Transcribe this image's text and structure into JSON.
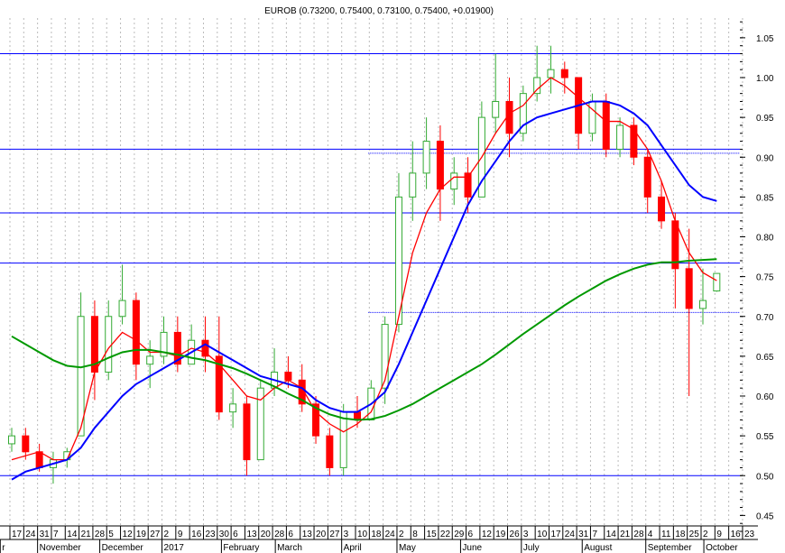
{
  "chart_data": {
    "type": "candlestick",
    "title": "EUROB (0.73200, 0.75400, 0.73100, 0.75400, +0.01900)",
    "xlabel": "",
    "ylabel": "",
    "ylim": [
      0.43,
      1.08
    ],
    "y_ticks": [
      "0.45",
      "0.50",
      "0.55",
      "0.60",
      "0.65",
      "0.70",
      "0.75",
      "0.80",
      "0.85",
      "0.90",
      "0.95",
      "1.00",
      "1.05"
    ],
    "week_labels": [
      "17",
      "24",
      "31",
      "7",
      "14",
      "21",
      "28",
      "5",
      "12",
      "19",
      "27",
      "2",
      "9",
      "16",
      "23",
      "30",
      "6",
      "13",
      "20",
      "28",
      "6",
      "13",
      "20",
      "27",
      "3",
      "10",
      "18",
      "24",
      "2",
      "8",
      "15",
      "22",
      "29",
      "6",
      "12",
      "19",
      "26",
      "3",
      "10",
      "17",
      "24",
      "31",
      "7",
      "14",
      "21",
      "28",
      "4",
      "11",
      "18",
      "25",
      "2",
      "9",
      "16",
      "23"
    ],
    "month_labels": [
      {
        "label": "r",
        "week": -0.7
      },
      {
        "label": "November",
        "week": 2
      },
      {
        "label": "December",
        "week": 6.5
      },
      {
        "label": "2017",
        "week": 11
      },
      {
        "label": "February",
        "week": 15.3
      },
      {
        "label": "March",
        "week": 19.2
      },
      {
        "label": "April",
        "week": 24
      },
      {
        "label": "May",
        "week": 28
      },
      {
        "label": "June",
        "week": 32.6
      },
      {
        "label": "July",
        "week": 37
      },
      {
        "label": "August",
        "week": 41.4
      },
      {
        "label": "September",
        "week": 46
      },
      {
        "label": "October",
        "week": 50.2
      }
    ],
    "candles": [
      [
        0.54,
        0.56,
        0.53,
        0.55
      ],
      [
        0.55,
        0.56,
        0.52,
        0.53
      ],
      [
        0.53,
        0.54,
        0.505,
        0.51
      ],
      [
        0.51,
        0.53,
        0.49,
        0.52
      ],
      [
        0.52,
        0.535,
        0.51,
        0.53
      ],
      [
        0.55,
        0.73,
        0.55,
        0.7
      ],
      [
        0.7,
        0.72,
        0.595,
        0.63
      ],
      [
        0.63,
        0.72,
        0.62,
        0.7
      ],
      [
        0.7,
        0.765,
        0.69,
        0.72
      ],
      [
        0.72,
        0.73,
        0.62,
        0.64
      ],
      [
        0.64,
        0.67,
        0.61,
        0.65
      ],
      [
        0.65,
        0.7,
        0.64,
        0.68
      ],
      [
        0.68,
        0.7,
        0.63,
        0.64
      ],
      [
        0.64,
        0.69,
        0.64,
        0.67
      ],
      [
        0.67,
        0.7,
        0.63,
        0.65
      ],
      [
        0.65,
        0.7,
        0.57,
        0.58
      ],
      [
        0.58,
        0.61,
        0.56,
        0.59
      ],
      [
        0.59,
        0.6,
        0.5,
        0.52
      ],
      [
        0.52,
        0.62,
        0.52,
        0.61
      ],
      [
        0.61,
        0.66,
        0.6,
        0.63
      ],
      [
        0.63,
        0.65,
        0.61,
        0.62
      ],
      [
        0.62,
        0.64,
        0.58,
        0.59
      ],
      [
        0.59,
        0.6,
        0.54,
        0.55
      ],
      [
        0.55,
        0.56,
        0.5,
        0.51
      ],
      [
        0.51,
        0.59,
        0.5,
        0.58
      ],
      [
        0.58,
        0.6,
        0.56,
        0.57
      ],
      [
        0.57,
        0.62,
        0.57,
        0.61
      ],
      [
        0.61,
        0.7,
        0.59,
        0.69
      ],
      [
        0.69,
        0.88,
        0.68,
        0.85
      ],
      [
        0.85,
        0.92,
        0.82,
        0.88
      ],
      [
        0.88,
        0.95,
        0.86,
        0.92
      ],
      [
        0.92,
        0.94,
        0.82,
        0.86
      ],
      [
        0.86,
        0.9,
        0.84,
        0.88
      ],
      [
        0.88,
        0.9,
        0.83,
        0.85
      ],
      [
        0.85,
        0.97,
        0.85,
        0.95
      ],
      [
        0.95,
        1.03,
        0.93,
        0.97
      ],
      [
        0.97,
        1.0,
        0.9,
        0.93
      ],
      [
        0.93,
        0.99,
        0.92,
        0.98
      ],
      [
        0.98,
        1.04,
        0.97,
        1.0
      ],
      [
        1.0,
        1.04,
        0.98,
        1.01
      ],
      [
        1.01,
        1.02,
        0.98,
        1.0
      ],
      [
        1.0,
        1.0,
        0.91,
        0.93
      ],
      [
        0.93,
        0.98,
        0.92,
        0.97
      ],
      [
        0.97,
        0.98,
        0.9,
        0.91
      ],
      [
        0.91,
        0.95,
        0.9,
        0.94
      ],
      [
        0.94,
        0.95,
        0.89,
        0.9
      ],
      [
        0.9,
        0.91,
        0.83,
        0.85
      ],
      [
        0.85,
        0.87,
        0.81,
        0.82
      ],
      [
        0.82,
        0.83,
        0.71,
        0.76
      ],
      [
        0.76,
        0.81,
        0.6,
        0.71
      ],
      [
        0.71,
        0.76,
        0.69,
        0.72
      ],
      [
        0.732,
        0.754,
        0.731,
        0.754
      ]
    ],
    "series": [
      {
        "name": "short MA",
        "color": "#ff0000",
        "values": [
          0.52,
          0.525,
          0.53,
          0.52,
          0.52,
          0.56,
          0.63,
          0.66,
          0.68,
          0.67,
          0.655,
          0.655,
          0.65,
          0.66,
          0.655,
          0.64,
          0.62,
          0.6,
          0.595,
          0.61,
          0.62,
          0.61,
          0.58,
          0.565,
          0.555,
          0.565,
          0.58,
          0.62,
          0.7,
          0.78,
          0.83,
          0.86,
          0.875,
          0.875,
          0.9,
          0.93,
          0.955,
          0.965,
          0.985,
          1.0,
          0.99,
          0.975,
          0.96,
          0.945,
          0.945,
          0.935,
          0.91,
          0.87,
          0.82,
          0.78,
          0.755,
          0.745
        ]
      },
      {
        "name": "medium MA",
        "color": "#0000ff",
        "values": [
          0.495,
          0.505,
          0.51,
          0.515,
          0.52,
          0.535,
          0.56,
          0.58,
          0.6,
          0.615,
          0.625,
          0.635,
          0.645,
          0.655,
          0.665,
          0.655,
          0.645,
          0.635,
          0.625,
          0.62,
          0.615,
          0.61,
          0.595,
          0.585,
          0.58,
          0.58,
          0.59,
          0.605,
          0.64,
          0.68,
          0.72,
          0.76,
          0.8,
          0.84,
          0.87,
          0.895,
          0.92,
          0.94,
          0.95,
          0.955,
          0.96,
          0.965,
          0.97,
          0.97,
          0.965,
          0.955,
          0.94,
          0.915,
          0.89,
          0.865,
          0.85,
          0.845
        ]
      },
      {
        "name": "long MA",
        "color": "#009900",
        "values": [
          0.675,
          0.665,
          0.655,
          0.645,
          0.638,
          0.636,
          0.64,
          0.648,
          0.655,
          0.658,
          0.658,
          0.655,
          0.652,
          0.648,
          0.645,
          0.64,
          0.635,
          0.628,
          0.62,
          0.612,
          0.603,
          0.595,
          0.585,
          0.577,
          0.572,
          0.57,
          0.571,
          0.575,
          0.582,
          0.59,
          0.6,
          0.61,
          0.62,
          0.63,
          0.64,
          0.652,
          0.665,
          0.678,
          0.69,
          0.702,
          0.714,
          0.725,
          0.735,
          0.745,
          0.753,
          0.76,
          0.765,
          0.768,
          0.768,
          0.77,
          0.771,
          0.772
        ]
      }
    ],
    "horizontal_lines": [
      {
        "value": 1.03,
        "style": "solid",
        "from_week": -1
      },
      {
        "value": 0.91,
        "style": "solid",
        "from_week": -1
      },
      {
        "value": 0.905,
        "style": "dotted",
        "from_week": 25.8
      },
      {
        "value": 0.83,
        "style": "solid",
        "from_week": -1
      },
      {
        "value": 0.767,
        "style": "solid",
        "from_week": -1
      },
      {
        "value": 0.705,
        "style": "dotted",
        "from_week": 25.8
      },
      {
        "value": 0.5,
        "style": "solid",
        "from_week": -1
      }
    ],
    "grid": true,
    "colors": {
      "up": "#33aa33",
      "down": "#ff0000",
      "level": "#0000ff"
    }
  }
}
